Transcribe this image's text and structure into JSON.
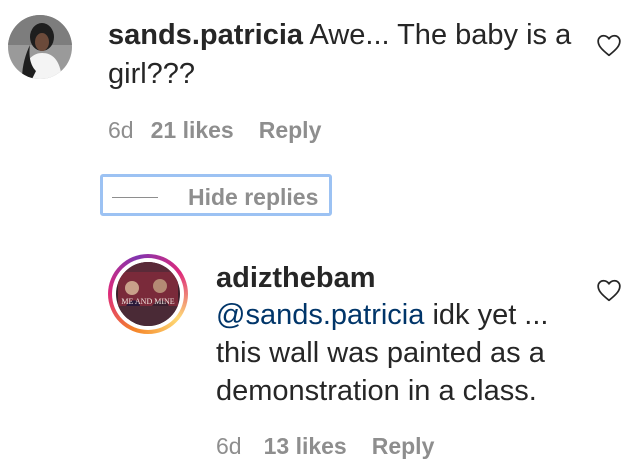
{
  "comment": {
    "username": "sands.patricia",
    "text": "Awe... The baby is a girl???",
    "time": "6d",
    "likes": "21 likes",
    "reply_label": "Reply"
  },
  "replies_toggle": {
    "label": "Hide replies"
  },
  "reply": {
    "username": "adizthebam",
    "mention": "@sands.patricia",
    "text": "idk yet ... this wall was painted as a demonstration in a class.",
    "time": "6d",
    "likes": "13 likes",
    "reply_label": "Reply",
    "avatar_caption": "ME AND MINE"
  },
  "icons": {
    "like": "heart-outline-icon"
  },
  "colors": {
    "text": "#262626",
    "meta": "#8e8e8e",
    "mention": "#003569",
    "focus_ring": "#9cc2f3"
  }
}
